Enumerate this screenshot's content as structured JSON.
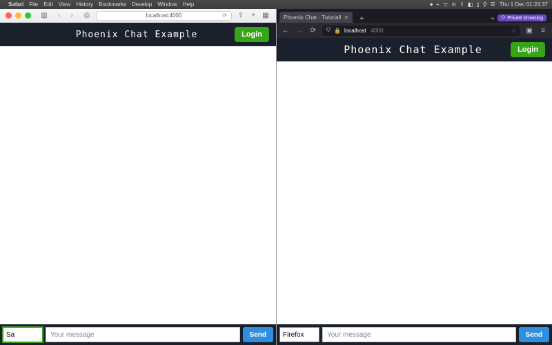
{
  "menubar": {
    "app_name": "Safari",
    "items": [
      "File",
      "Edit",
      "View",
      "History",
      "Bookmarks",
      "Develop",
      "Window",
      "Help"
    ],
    "clock": "Thu 1 Dec  01:24:37"
  },
  "safari": {
    "url": "localhost:4000",
    "app_title": "Phoenix Chat Example",
    "login_label": "Login",
    "name_value": "Sa",
    "msg_placeholder": "Your message",
    "send_label": "Send"
  },
  "firefox": {
    "tab_title": "Phoenix Chat · Tutorial!",
    "private_label": "Private browsing",
    "url_host": "localhost",
    "url_port": ":4000",
    "app_title": "Phoenix Chat Example",
    "login_label": "Login",
    "name_value": "Firefox",
    "msg_placeholder": "Your message",
    "send_label": "Send"
  }
}
